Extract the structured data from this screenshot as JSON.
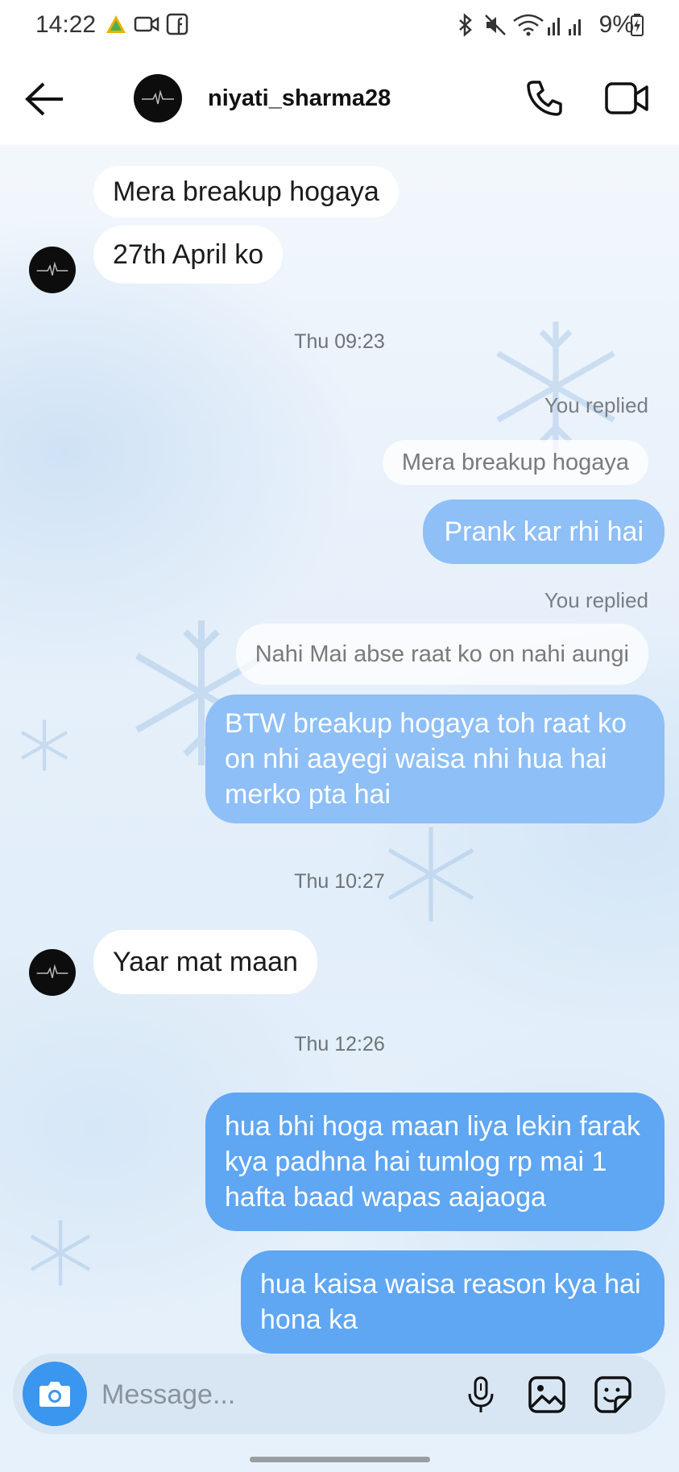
{
  "status_bar": {
    "time": "14:22",
    "battery": "9%",
    "icons": [
      "warning-triangle-icon",
      "video-call-icon",
      "facebook-icon",
      "bluetooth-icon",
      "mute-icon",
      "wifi-icon",
      "signal-icon"
    ]
  },
  "header": {
    "username": "niyati_sharma28",
    "back_icon": "back-arrow-icon",
    "call_icon": "phone-icon",
    "video_icon": "video-camera-icon"
  },
  "messages": {
    "m1": "Mera breakup hogaya",
    "m2": "27th April ko",
    "ts1": "Thu 09:23",
    "reply_label_1": "You replied",
    "quote_1": "Mera breakup hogaya",
    "m3": "Prank kar rhi hai",
    "reply_label_2": "You replied",
    "quote_2": "Nahi Mai abse raat ko on nahi aungi",
    "m4_l1": "BTW breakup hogaya toh raat ko",
    "m4_l2": "on nhi aayegi waisa nhi hua hai",
    "m4_l3": "merko pta hai",
    "ts2": "Thu 10:27",
    "m5": "Yaar mat maan",
    "ts3": "Thu 12:26",
    "m6_l1": "hua bhi hoga maan liya lekin farak",
    "m6_l2": "kya padhna hai tumlog rp mai 1",
    "m6_l3": "hafta baad wapas aajaoga",
    "m7_l1": "hua kaisa waisa reason kya hai",
    "m7_l2": "hona ka"
  },
  "composer": {
    "placeholder": "Message...",
    "icons": [
      "camera-icon",
      "microphone-icon",
      "gallery-icon",
      "sticker-icon"
    ]
  },
  "colors": {
    "outgoing_light": "#8ebff7",
    "outgoing_strong": "#5fa6f3",
    "camera_button": "#3a96ee"
  }
}
